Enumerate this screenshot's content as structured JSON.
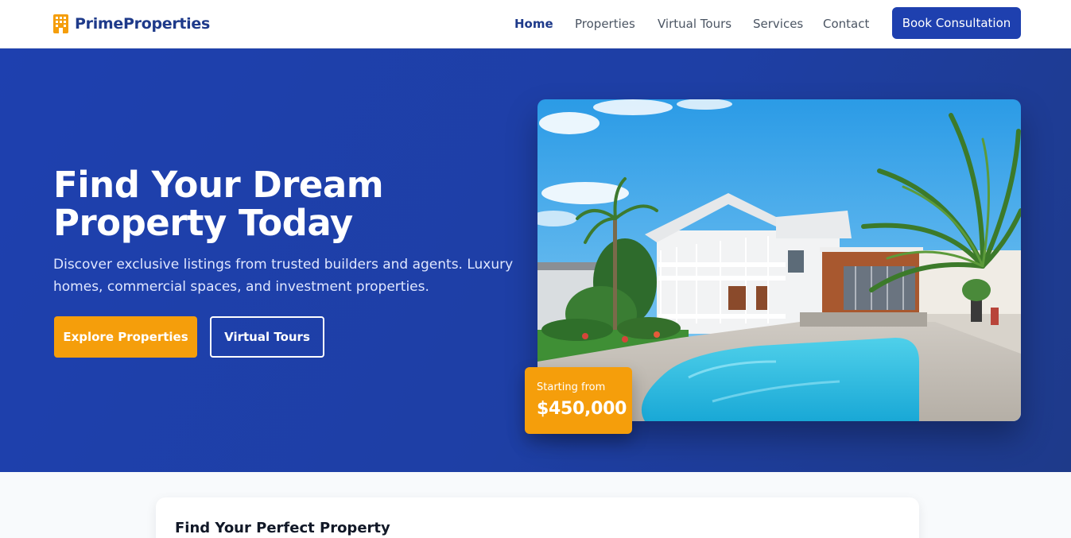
{
  "brand": {
    "name": "PrimeProperties",
    "icon": "building-icon",
    "color": "#1e3a8a",
    "icon_color": "#f59e0b"
  },
  "nav": {
    "items": [
      {
        "label": "Home",
        "active": true
      },
      {
        "label": "Properties",
        "active": false
      },
      {
        "label": "Virtual Tours",
        "active": false
      },
      {
        "label": "Services",
        "active": false
      },
      {
        "label": "Contact",
        "active": false
      }
    ],
    "cta_label": "Book Consultation"
  },
  "hero": {
    "title": "Find Your Dream Property Today",
    "subtitle": "Discover exclusive listings from trusted builders and agents. Luxury homes, commercial spaces, and investment properties.",
    "primary_button": "Explore Properties",
    "secondary_button": "Virtual Tours",
    "price_label": "Starting from",
    "price_value": "$450,000"
  },
  "search": {
    "title": "Find Your Perfect Property"
  },
  "colors": {
    "primary": "#1e40af",
    "accent": "#f59e0b",
    "background": "#f8fafc"
  }
}
